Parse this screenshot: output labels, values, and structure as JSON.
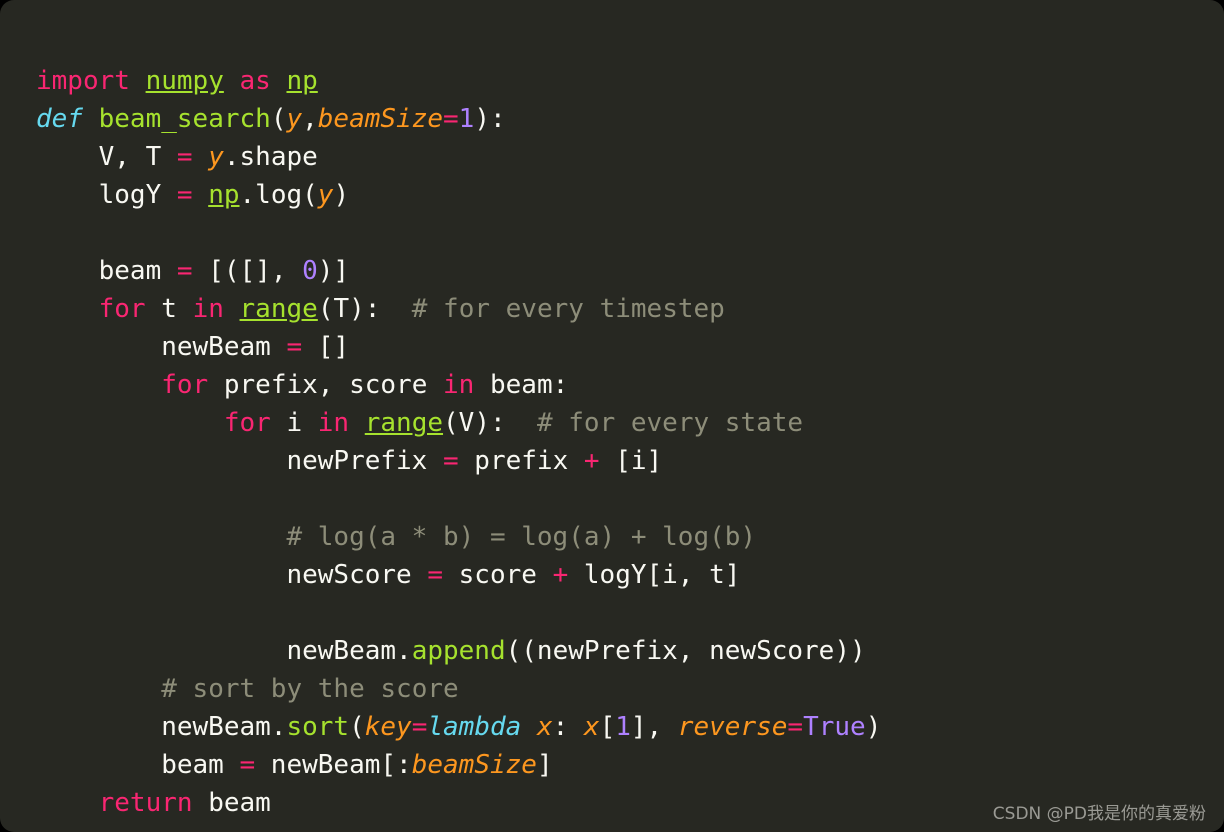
{
  "card": {
    "background": "#272822",
    "corner_radius_px": 14
  },
  "theme": {
    "name": "monokai",
    "background": "#272822",
    "foreground": "#f8f8f2",
    "keyword": "#f92672",
    "operator": "#f92672",
    "declaration": "#66d9ef",
    "function": "#a6e22e",
    "module": "#a6e22e",
    "parameter": "#fd971f",
    "number": "#ae81ff",
    "comment": "#8d8d79",
    "watermark": "#9a9a94"
  },
  "code": {
    "language": "python",
    "font_size_px": 26,
    "line_height_px": 38,
    "lines": [
      {
        "index": 1,
        "text": "import numpy as np",
        "tokens": [
          {
            "t": "import",
            "c": "kw"
          },
          {
            "t": " ",
            "c": "txt"
          },
          {
            "t": "numpy",
            "c": "mod"
          },
          {
            "t": " ",
            "c": "txt"
          },
          {
            "t": "as",
            "c": "kw"
          },
          {
            "t": " ",
            "c": "txt"
          },
          {
            "t": "np",
            "c": "mod"
          }
        ]
      },
      {
        "index": 2,
        "text": "def beam_search(y,beamSize=1):",
        "tokens": [
          {
            "t": "def",
            "c": "def"
          },
          {
            "t": " ",
            "c": "txt"
          },
          {
            "t": "beam_search",
            "c": "fn"
          },
          {
            "t": "(",
            "c": "txt"
          },
          {
            "t": "y",
            "c": "param"
          },
          {
            "t": ",",
            "c": "txt"
          },
          {
            "t": "beamSize",
            "c": "param"
          },
          {
            "t": "=",
            "c": "op"
          },
          {
            "t": "1",
            "c": "num"
          },
          {
            "t": "):",
            "c": "txt"
          }
        ]
      },
      {
        "index": 3,
        "text": "    V, T = y.shape",
        "tokens": [
          {
            "t": "    V, T ",
            "c": "txt"
          },
          {
            "t": "=",
            "c": "op"
          },
          {
            "t": " ",
            "c": "txt"
          },
          {
            "t": "y",
            "c": "param"
          },
          {
            "t": ".shape",
            "c": "txt"
          }
        ]
      },
      {
        "index": 4,
        "text": "    logY = np.log(y)",
        "tokens": [
          {
            "t": "    logY ",
            "c": "txt"
          },
          {
            "t": "=",
            "c": "op"
          },
          {
            "t": " ",
            "c": "txt"
          },
          {
            "t": "np",
            "c": "mod"
          },
          {
            "t": ".log(",
            "c": "txt"
          },
          {
            "t": "y",
            "c": "param"
          },
          {
            "t": ")",
            "c": "txt"
          }
        ]
      },
      {
        "index": 5,
        "text": "",
        "tokens": []
      },
      {
        "index": 6,
        "text": "    beam = [([], 0)]",
        "tokens": [
          {
            "t": "    beam ",
            "c": "txt"
          },
          {
            "t": "=",
            "c": "op"
          },
          {
            "t": " [([], ",
            "c": "txt"
          },
          {
            "t": "0",
            "c": "num"
          },
          {
            "t": ")]",
            "c": "txt"
          }
        ]
      },
      {
        "index": 7,
        "text": "    for t in range(T):  # for every timestep",
        "tokens": [
          {
            "t": "    ",
            "c": "txt"
          },
          {
            "t": "for",
            "c": "kw"
          },
          {
            "t": " t ",
            "c": "txt"
          },
          {
            "t": "in",
            "c": "kw"
          },
          {
            "t": " ",
            "c": "txt"
          },
          {
            "t": "range",
            "c": "mod"
          },
          {
            "t": "(T):  ",
            "c": "txt"
          },
          {
            "t": "# for every timestep",
            "c": "cmt"
          }
        ]
      },
      {
        "index": 8,
        "text": "        newBeam = []",
        "tokens": [
          {
            "t": "        newBeam ",
            "c": "txt"
          },
          {
            "t": "=",
            "c": "op"
          },
          {
            "t": " []",
            "c": "txt"
          }
        ]
      },
      {
        "index": 9,
        "text": "        for prefix, score in beam:",
        "tokens": [
          {
            "t": "        ",
            "c": "txt"
          },
          {
            "t": "for",
            "c": "kw"
          },
          {
            "t": " prefix, score ",
            "c": "txt"
          },
          {
            "t": "in",
            "c": "kw"
          },
          {
            "t": " beam:",
            "c": "txt"
          }
        ]
      },
      {
        "index": 10,
        "text": "            for i in range(V):  # for every state",
        "tokens": [
          {
            "t": "            ",
            "c": "txt"
          },
          {
            "t": "for",
            "c": "kw"
          },
          {
            "t": " i ",
            "c": "txt"
          },
          {
            "t": "in",
            "c": "kw"
          },
          {
            "t": " ",
            "c": "txt"
          },
          {
            "t": "range",
            "c": "mod"
          },
          {
            "t": "(V):  ",
            "c": "txt"
          },
          {
            "t": "# for every state",
            "c": "cmt"
          }
        ]
      },
      {
        "index": 11,
        "text": "                newPrefix = prefix + [i]",
        "tokens": [
          {
            "t": "                newPrefix ",
            "c": "txt"
          },
          {
            "t": "=",
            "c": "op"
          },
          {
            "t": " prefix ",
            "c": "txt"
          },
          {
            "t": "+",
            "c": "op"
          },
          {
            "t": " [i]",
            "c": "txt"
          }
        ]
      },
      {
        "index": 12,
        "text": "",
        "tokens": []
      },
      {
        "index": 13,
        "text": "                # log(a * b) = log(a) + log(b)",
        "tokens": [
          {
            "t": "                ",
            "c": "txt"
          },
          {
            "t": "# log(a * b) = log(a) + log(b)",
            "c": "cmt"
          }
        ]
      },
      {
        "index": 14,
        "text": "                newScore = score + logY[i, t]",
        "tokens": [
          {
            "t": "                newScore ",
            "c": "txt"
          },
          {
            "t": "=",
            "c": "op"
          },
          {
            "t": " score ",
            "c": "txt"
          },
          {
            "t": "+",
            "c": "op"
          },
          {
            "t": " logY[i, t]",
            "c": "txt"
          }
        ]
      },
      {
        "index": 15,
        "text": "",
        "tokens": []
      },
      {
        "index": 16,
        "text": "                newBeam.append((newPrefix, newScore))",
        "tokens": [
          {
            "t": "                newBeam.",
            "c": "txt"
          },
          {
            "t": "append",
            "c": "fn"
          },
          {
            "t": "((newPrefix, newScore))",
            "c": "txt"
          }
        ]
      },
      {
        "index": 17,
        "text": "        # sort by the score",
        "tokens": [
          {
            "t": "        ",
            "c": "txt"
          },
          {
            "t": "# sort by the score",
            "c": "cmt"
          }
        ]
      },
      {
        "index": 18,
        "text": "        newBeam.sort(key=lambda x: x[1], reverse=True)",
        "tokens": [
          {
            "t": "        newBeam.",
            "c": "txt"
          },
          {
            "t": "sort",
            "c": "fn"
          },
          {
            "t": "(",
            "c": "txt"
          },
          {
            "t": "key",
            "c": "param"
          },
          {
            "t": "=",
            "c": "op"
          },
          {
            "t": "lambda",
            "c": "def"
          },
          {
            "t": " ",
            "c": "txt"
          },
          {
            "t": "x",
            "c": "param"
          },
          {
            "t": ": ",
            "c": "txt"
          },
          {
            "t": "x",
            "c": "param"
          },
          {
            "t": "[",
            "c": "txt"
          },
          {
            "t": "1",
            "c": "num"
          },
          {
            "t": "], ",
            "c": "txt"
          },
          {
            "t": "reverse",
            "c": "param"
          },
          {
            "t": "=",
            "c": "op"
          },
          {
            "t": "True",
            "c": "num"
          },
          {
            "t": ")",
            "c": "txt"
          }
        ]
      },
      {
        "index": 19,
        "text": "        beam = newBeam[:beamSize]",
        "tokens": [
          {
            "t": "        beam ",
            "c": "txt"
          },
          {
            "t": "=",
            "c": "op"
          },
          {
            "t": " newBeam[:",
            "c": "txt"
          },
          {
            "t": "beamSize",
            "c": "param"
          },
          {
            "t": "]",
            "c": "txt"
          }
        ]
      },
      {
        "index": 20,
        "text": "    return beam",
        "tokens": [
          {
            "t": "    ",
            "c": "txt"
          },
          {
            "t": "return",
            "c": "kw"
          },
          {
            "t": " beam",
            "c": "txt"
          }
        ]
      }
    ]
  },
  "watermark": {
    "text": "CSDN @PD我是你的真爱粉"
  }
}
